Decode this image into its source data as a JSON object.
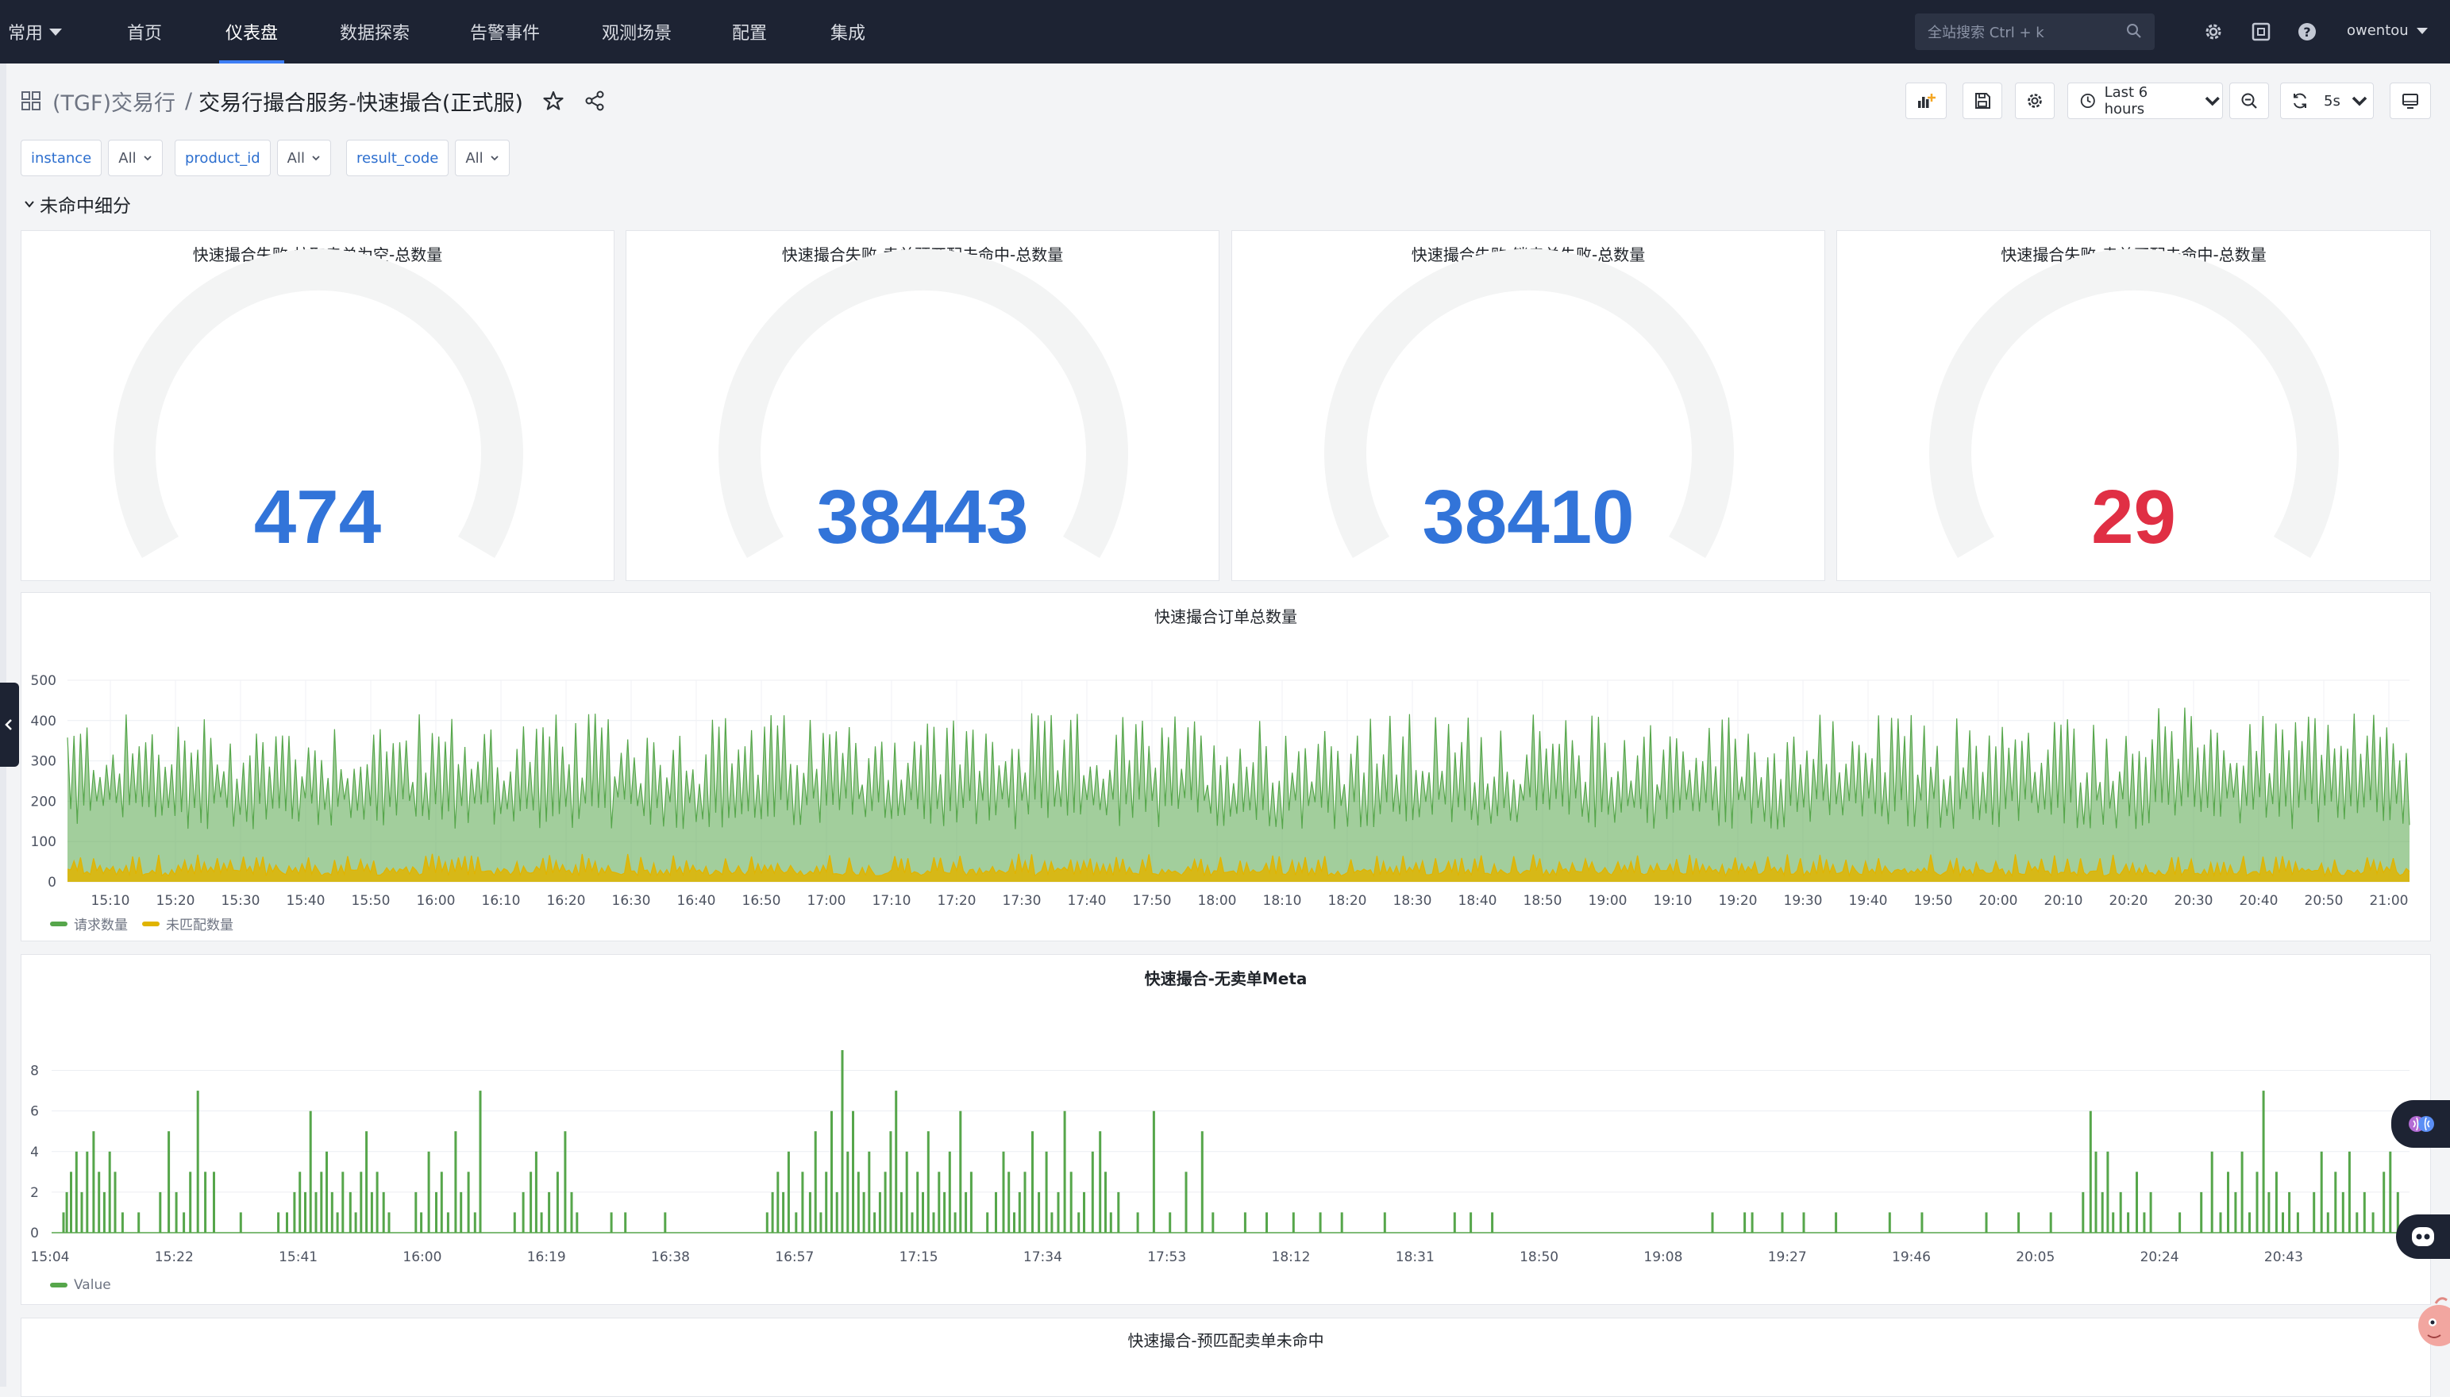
{
  "nav": {
    "menu_label": "常用",
    "items": [
      "首页",
      "仪表盘",
      "数据探索",
      "告警事件",
      "观测场景",
      "配置",
      "集成"
    ],
    "active_index": 1,
    "search_placeholder": "全站搜索 Ctrl + k",
    "user": "owentou"
  },
  "breadcrumb": {
    "folder": "(TGF)交易行",
    "separator": "/",
    "title": "交易行撮合服务-快速撮合(正式服)"
  },
  "toolbar": {
    "time_range": "Last 6 hours",
    "refresh_interval": "5s"
  },
  "variables": [
    {
      "name": "instance",
      "value": "All"
    },
    {
      "name": "product_id",
      "value": "All"
    },
    {
      "name": "result_code",
      "value": "All"
    }
  ],
  "row": {
    "title": "未命中细分"
  },
  "gauges": [
    {
      "title": "快速撮合失败-拉取卖单为空-总数量",
      "value": "474",
      "color": "#3274d9"
    },
    {
      "title": "快速撮合失败-卖单预匹配未命中-总数量",
      "value": "38443",
      "color": "#3274d9"
    },
    {
      "title": "快速撮合失败-锁卖单失败-总数量",
      "value": "38410",
      "color": "#3274d9"
    },
    {
      "title": "快速撮合失败-卖单匹配未命中-总数量",
      "value": "29",
      "color": "#e02f44"
    }
  ],
  "chart_data": [
    {
      "type": "area",
      "title": "快速撮合订单总数量",
      "xlabel": "",
      "ylabel": "",
      "ylim": [
        0,
        500
      ],
      "y_ticks": [
        0,
        100,
        200,
        300,
        400,
        500
      ],
      "x_ticks": [
        "15:10",
        "15:20",
        "15:30",
        "15:40",
        "15:50",
        "16:00",
        "16:10",
        "16:20",
        "16:30",
        "16:40",
        "16:50",
        "17:00",
        "17:10",
        "17:20",
        "17:30",
        "17:40",
        "17:50",
        "18:00",
        "18:10",
        "18:20",
        "18:30",
        "18:40",
        "18:50",
        "19:00",
        "19:10",
        "19:20",
        "19:30",
        "19:40",
        "19:50",
        "20:00",
        "20:10",
        "20:20",
        "20:30",
        "20:40",
        "20:50",
        "21:00"
      ],
      "grid": true,
      "legend_position": "bottom-left",
      "series": [
        {
          "name": "请求数量",
          "color": "#56a64b",
          "typical_range": [
            130,
            420
          ],
          "peak": 490
        },
        {
          "name": "未匹配数量",
          "color": "#e0b400",
          "typical_range": [
            15,
            70
          ],
          "peak": 80
        }
      ]
    },
    {
      "type": "bar",
      "title": "快速撮合-无卖单Meta",
      "xlabel": "",
      "ylabel": "",
      "ylim": [
        0,
        9
      ],
      "y_ticks": [
        0,
        2,
        4,
        6,
        8
      ],
      "x_ticks": [
        "15:04",
        "15:22",
        "15:41",
        "16:00",
        "16:19",
        "16:38",
        "16:57",
        "17:15",
        "17:34",
        "17:53",
        "18:12",
        "18:31",
        "18:50",
        "19:08",
        "19:27",
        "19:46",
        "20:05",
        "20:24",
        "20:43"
      ],
      "grid": true,
      "legend_position": "bottom-left",
      "series": [
        {
          "name": "Value",
          "color": "#56a64b"
        }
      ],
      "bars": [
        [
          15.1,
          1
        ],
        [
          15.13,
          2
        ],
        [
          15.17,
          3
        ],
        [
          15.22,
          4
        ],
        [
          15.27,
          2
        ],
        [
          15.32,
          4
        ],
        [
          15.38,
          5
        ],
        [
          15.43,
          3
        ],
        [
          15.48,
          2
        ],
        [
          15.53,
          4
        ],
        [
          15.58,
          3
        ],
        [
          15.65,
          1
        ],
        [
          15.8,
          1
        ],
        [
          16.0,
          2
        ],
        [
          16.08,
          5
        ],
        [
          16.15,
          2
        ],
        [
          16.22,
          1
        ],
        [
          16.28,
          3
        ],
        [
          16.35,
          7
        ],
        [
          16.42,
          3
        ],
        [
          16.5,
          3
        ],
        [
          16.75,
          1
        ],
        [
          17.1,
          1
        ],
        [
          17.18,
          1
        ],
        [
          17.25,
          2
        ],
        [
          17.3,
          3
        ],
        [
          17.35,
          2
        ],
        [
          17.4,
          6
        ],
        [
          17.45,
          2
        ],
        [
          17.5,
          3
        ],
        [
          17.55,
          4
        ],
        [
          17.6,
          2
        ],
        [
          17.65,
          1
        ],
        [
          17.7,
          3
        ],
        [
          17.77,
          2
        ],
        [
          17.82,
          1
        ],
        [
          17.87,
          3
        ],
        [
          17.92,
          5
        ],
        [
          17.97,
          2
        ],
        [
          18.02,
          3
        ],
        [
          18.08,
          2
        ],
        [
          18.13,
          1
        ],
        [
          18.38,
          2
        ],
        [
          18.43,
          1
        ],
        [
          18.5,
          4
        ],
        [
          18.57,
          2
        ],
        [
          18.62,
          3
        ],
        [
          18.68,
          1
        ],
        [
          18.75,
          5
        ],
        [
          18.8,
          2
        ],
        [
          18.87,
          3
        ],
        [
          18.93,
          1
        ],
        [
          18.98,
          7
        ],
        [
          19.3,
          1
        ],
        [
          19.38,
          2
        ],
        [
          19.45,
          3
        ],
        [
          19.5,
          4
        ],
        [
          19.55,
          1
        ],
        [
          19.62,
          2
        ],
        [
          19.7,
          3
        ],
        [
          19.77,
          5
        ],
        [
          19.83,
          2
        ],
        [
          19.88,
          1
        ],
        [
          20.2,
          1
        ],
        [
          20.33,
          1
        ],
        [
          20.7,
          1
        ],
        [
          21.65,
          1
        ],
        [
          21.7,
          2
        ],
        [
          21.75,
          3
        ],
        [
          21.8,
          2
        ],
        [
          21.85,
          4
        ],
        [
          21.92,
          1
        ],
        [
          21.98,
          3
        ],
        [
          22.05,
          2
        ],
        [
          22.1,
          5
        ],
        [
          22.15,
          1
        ],
        [
          22.2,
          3
        ],
        [
          22.25,
          6
        ],
        [
          22.3,
          2
        ],
        [
          22.35,
          9
        ],
        [
          22.4,
          4
        ],
        [
          22.45,
          6
        ],
        [
          22.5,
          3
        ],
        [
          22.55,
          2
        ],
        [
          22.6,
          4
        ],
        [
          22.65,
          1
        ],
        [
          22.7,
          2
        ],
        [
          22.75,
          3
        ],
        [
          22.8,
          5
        ],
        [
          22.85,
          7
        ],
        [
          22.9,
          2
        ],
        [
          22.95,
          4
        ],
        [
          23.0,
          1
        ],
        [
          23.05,
          3
        ],
        [
          23.1,
          2
        ],
        [
          23.15,
          5
        ],
        [
          23.2,
          1
        ],
        [
          23.25,
          3
        ],
        [
          23.3,
          2
        ],
        [
          23.35,
          4
        ],
        [
          23.4,
          1
        ],
        [
          23.45,
          6
        ],
        [
          23.5,
          2
        ],
        [
          23.55,
          3
        ],
        [
          23.7,
          1
        ],
        [
          23.78,
          2
        ],
        [
          23.85,
          4
        ],
        [
          23.9,
          3
        ],
        [
          23.95,
          1
        ],
        [
          24.0,
          2
        ],
        [
          24.05,
          3
        ],
        [
          24.12,
          5
        ],
        [
          24.18,
          2
        ],
        [
          24.25,
          4
        ],
        [
          24.3,
          1
        ],
        [
          24.36,
          2
        ],
        [
          24.42,
          6
        ],
        [
          24.48,
          3
        ],
        [
          24.55,
          1
        ],
        [
          24.6,
          2
        ],
        [
          24.68,
          4
        ],
        [
          24.75,
          5
        ],
        [
          24.8,
          3
        ],
        [
          24.85,
          1
        ],
        [
          24.92,
          2
        ],
        [
          25.1,
          1
        ],
        [
          25.25,
          6
        ],
        [
          25.4,
          1
        ],
        [
          25.55,
          3
        ],
        [
          25.7,
          5
        ],
        [
          25.8,
          1
        ],
        [
          26.1,
          1
        ],
        [
          26.3,
          1
        ],
        [
          26.55,
          1
        ],
        [
          26.8,
          1
        ],
        [
          27.0,
          1
        ],
        [
          27.4,
          1
        ],
        [
          28.05,
          1
        ],
        [
          28.2,
          1
        ],
        [
          28.4,
          1
        ],
        [
          30.45,
          1
        ],
        [
          30.75,
          1
        ],
        [
          30.82,
          1
        ],
        [
          31.1,
          1
        ],
        [
          31.3,
          1
        ],
        [
          31.6,
          1
        ],
        [
          32.1,
          1
        ],
        [
          32.4,
          1
        ],
        [
          33.0,
          1
        ],
        [
          33.3,
          1
        ],
        [
          33.6,
          1
        ],
        [
          33.9,
          2
        ],
        [
          33.97,
          6
        ],
        [
          34.02,
          4
        ],
        [
          34.08,
          2
        ],
        [
          34.13,
          4
        ],
        [
          34.18,
          1
        ],
        [
          34.25,
          2
        ],
        [
          34.32,
          1
        ],
        [
          34.4,
          3
        ],
        [
          34.47,
          1
        ],
        [
          34.53,
          2
        ],
        [
          34.8,
          1
        ],
        [
          35.0,
          2
        ],
        [
          35.1,
          4
        ],
        [
          35.18,
          1
        ],
        [
          35.25,
          3
        ],
        [
          35.32,
          2
        ],
        [
          35.38,
          4
        ],
        [
          35.45,
          1
        ],
        [
          35.52,
          3
        ],
        [
          35.58,
          7
        ],
        [
          35.63,
          2
        ],
        [
          35.7,
          3
        ],
        [
          35.76,
          1
        ],
        [
          35.82,
          2
        ],
        [
          35.9,
          1
        ],
        [
          36.05,
          2
        ],
        [
          36.12,
          4
        ],
        [
          36.18,
          1
        ],
        [
          36.25,
          3
        ],
        [
          36.32,
          2
        ],
        [
          36.38,
          4
        ],
        [
          36.45,
          1
        ],
        [
          36.52,
          2
        ],
        [
          36.6,
          1
        ],
        [
          36.7,
          3
        ],
        [
          36.76,
          4
        ],
        [
          36.83,
          2
        ]
      ]
    },
    {
      "type": "line",
      "title": "快速撮合-预匹配卖单未命中"
    }
  ]
}
